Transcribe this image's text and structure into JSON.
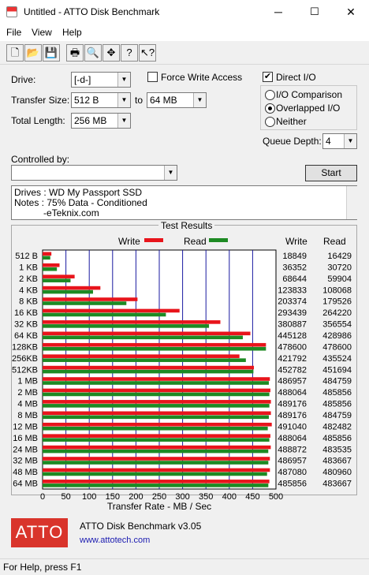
{
  "window": {
    "title": "Untitled - ATTO Disk Benchmark",
    "minimize": "─",
    "maximize": "☐",
    "close": "✕"
  },
  "menu": [
    "File",
    "View",
    "Help"
  ],
  "toolbar": [
    {
      "name": "new-icon",
      "glyph": "🗋"
    },
    {
      "name": "open-icon",
      "glyph": "📂"
    },
    {
      "name": "save-icon",
      "glyph": "💾"
    },
    {
      "name": "print-icon",
      "glyph": "🖶"
    },
    {
      "name": "print-preview-icon",
      "glyph": "🔍"
    },
    {
      "name": "move-icon",
      "glyph": "✥"
    },
    {
      "name": "help-icon",
      "glyph": "?"
    },
    {
      "name": "context-help-icon",
      "glyph": "↖?"
    }
  ],
  "form": {
    "drive_label": "Drive:",
    "drive_value": "[-d-]",
    "transfer_size_label": "Transfer Size:",
    "transfer_from": "512 B",
    "to_label": "to",
    "transfer_to": "64 MB",
    "total_length_label": "Total Length:",
    "total_length": "256 MB",
    "force_write_label": "Force Write Access",
    "force_write_checked": false,
    "direct_io_label": "Direct I/O",
    "direct_io_checked": true,
    "io_comparison_label": "I/O Comparison",
    "overlapped_io_label": "Overlapped I/O",
    "neither_label": "Neither",
    "selected_io_mode": "Overlapped I/O",
    "queue_depth_label": "Queue Depth:",
    "queue_depth": "4",
    "controlled_by_label": "Controlled by:",
    "controlled_by_value": "",
    "start_label": "Start",
    "notes_lines": [
      "Drives : WD My Passport SSD",
      "Notes : 75% Data - Conditioned",
      "-eTeknix.com"
    ]
  },
  "results": {
    "frame_title": "Test Results",
    "write_col": "Write",
    "read_col": "Read",
    "write_color": "#e8141b",
    "read_color": "#1d8a23",
    "grid_color": "#1a1aa0"
  },
  "chart_data": {
    "type": "bar",
    "orientation": "horizontal",
    "xlabel": "Transfer Rate - MB / Sec",
    "xlim": [
      0,
      500
    ],
    "xticks": [
      0,
      50,
      100,
      150,
      200,
      250,
      300,
      350,
      400,
      450,
      500
    ],
    "categories": [
      "512 B",
      "1 KB",
      "2 KB",
      "4 KB",
      "8 KB",
      "16 KB",
      "32 KB",
      "64 KB",
      "128KB",
      "256KB",
      "512KB",
      "1 MB",
      "2 MB",
      "4 MB",
      "8 MB",
      "12 MB",
      "16 MB",
      "24 MB",
      "32 MB",
      "48 MB",
      "64 MB"
    ],
    "series": [
      {
        "name": "Write",
        "values": [
          18849,
          36352,
          68644,
          123833,
          203374,
          293439,
          380887,
          445128,
          478600,
          421792,
          452782,
          486957,
          488064,
          489176,
          489176,
          491040,
          488064,
          488872,
          486957,
          487080,
          485856
        ]
      },
      {
        "name": "Read",
        "values": [
          16429,
          30720,
          59904,
          108068,
          179526,
          264220,
          356554,
          428986,
          478600,
          435524,
          451694,
          484759,
          485856,
          485856,
          484759,
          482482,
          485856,
          483535,
          483667,
          480960,
          483667
        ]
      }
    ],
    "units_note": "values shown in KB/s"
  },
  "footer": {
    "logo_text": "ATTO",
    "product": "ATTO Disk Benchmark v3.05",
    "link": "www.attotech.com"
  },
  "status": "For Help, press F1"
}
